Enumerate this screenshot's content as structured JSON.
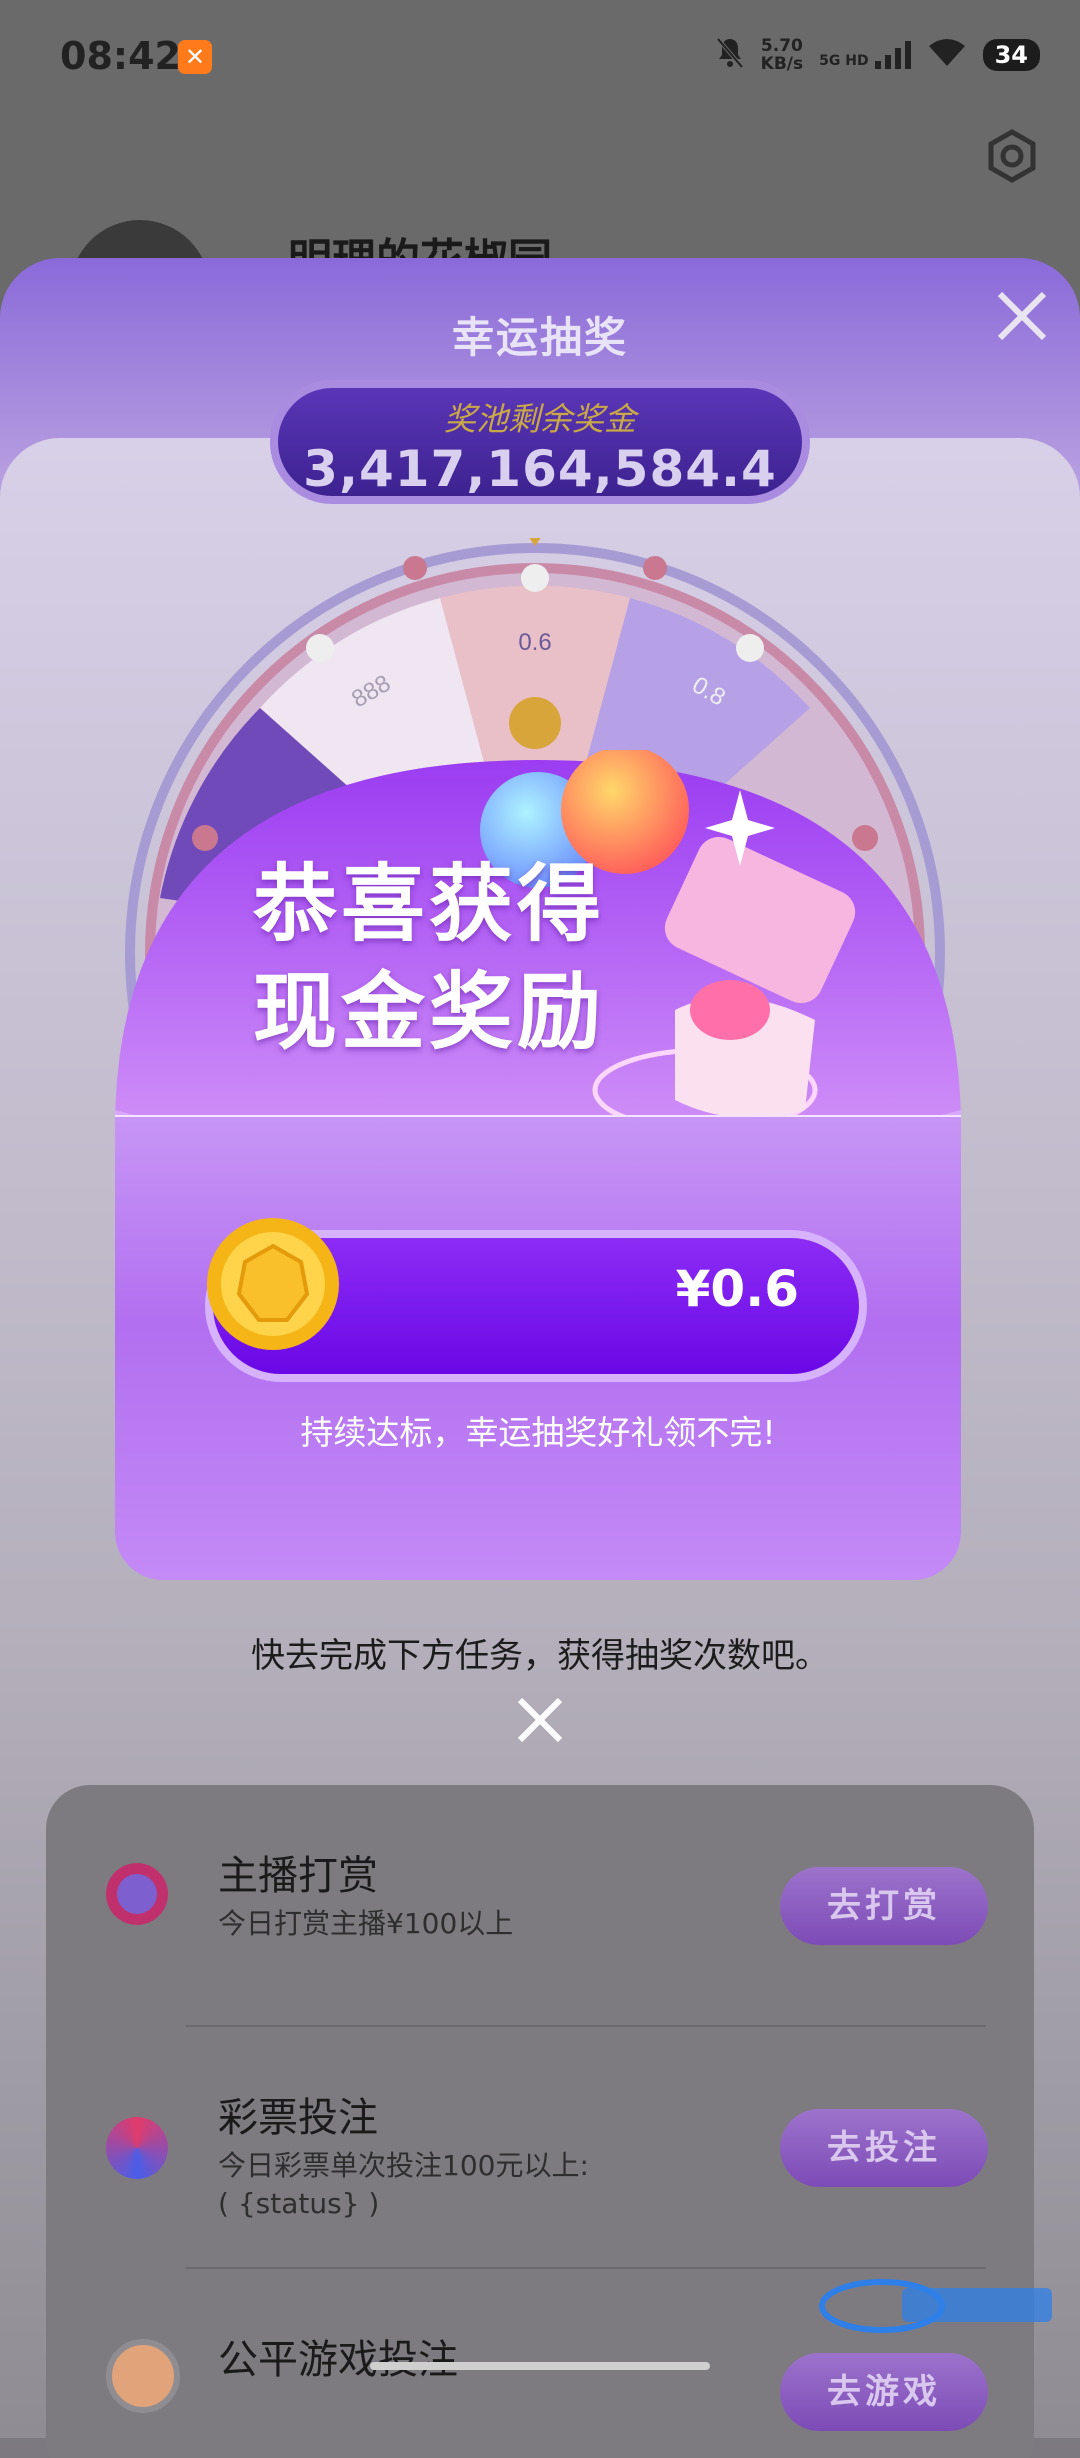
{
  "status_bar": {
    "time": "08:42",
    "net_speed_value": "5.70",
    "net_speed_unit": "KB/s",
    "network": "5G HD",
    "battery": "34"
  },
  "profile": {
    "name": "明理的花椒园"
  },
  "lottery": {
    "title": "幸运抽奖",
    "pool_label": "奖池剩余奖金",
    "pool_value": "3,417,164,584.4",
    "wheel_labels": [
      "0.6",
      "888",
      "0.8"
    ],
    "tasks_hint": "快去完成下方任务，获得抽奖次数吧。"
  },
  "result_modal": {
    "line1": "恭喜获得",
    "line2": "现金奖励",
    "amount": "¥0.6",
    "note": "持续达标，幸运抽奖好礼领不完!"
  },
  "tasks": [
    {
      "title": "主播打赏",
      "desc": "今日打赏主播¥100以上",
      "button": "去打赏",
      "icon": "chip-icon"
    },
    {
      "title": "彩票投注",
      "desc": "今日彩票单次投注100元以上:\n( {status} )",
      "button": "去投注",
      "icon": "lottery-ball-icon"
    },
    {
      "title": "公平游戏投注",
      "desc": "",
      "button": "去游戏",
      "icon": "corgi-icon"
    }
  ],
  "colors": {
    "modal_purple": "#b26ff0",
    "amount_bar": "#7a14ee",
    "pool_gold": "#c9a847"
  }
}
